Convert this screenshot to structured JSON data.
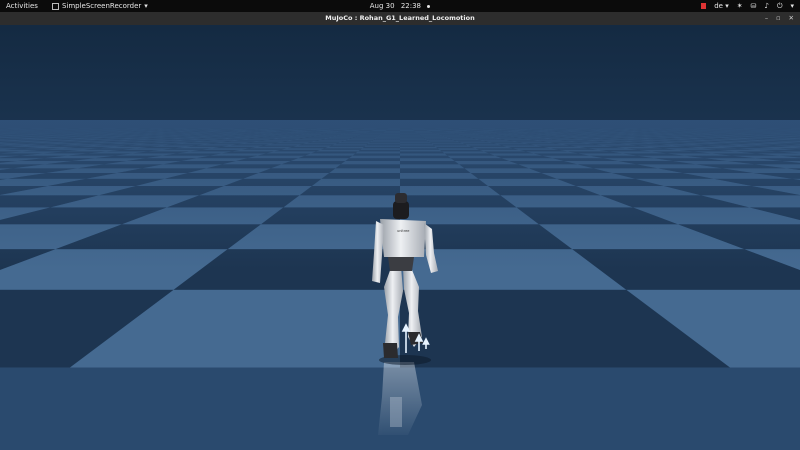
{
  "topbar": {
    "activities_label": "Activities",
    "app_menu_label": "SimpleScreenRecorder",
    "date": "Aug 30",
    "time": "22:38",
    "keyboard_layout": "de"
  },
  "window": {
    "title": "MuJoCo : Rohan_G1_Learned_Locomotion"
  },
  "scene": {
    "robot_chest_label": "unitree",
    "colors": {
      "sky_top": "#152c45",
      "horizon": "#2e4f76",
      "tile_dark": "#1d3551",
      "tile_light": "#456a91",
      "robot_body": "#d8dbe0"
    }
  }
}
